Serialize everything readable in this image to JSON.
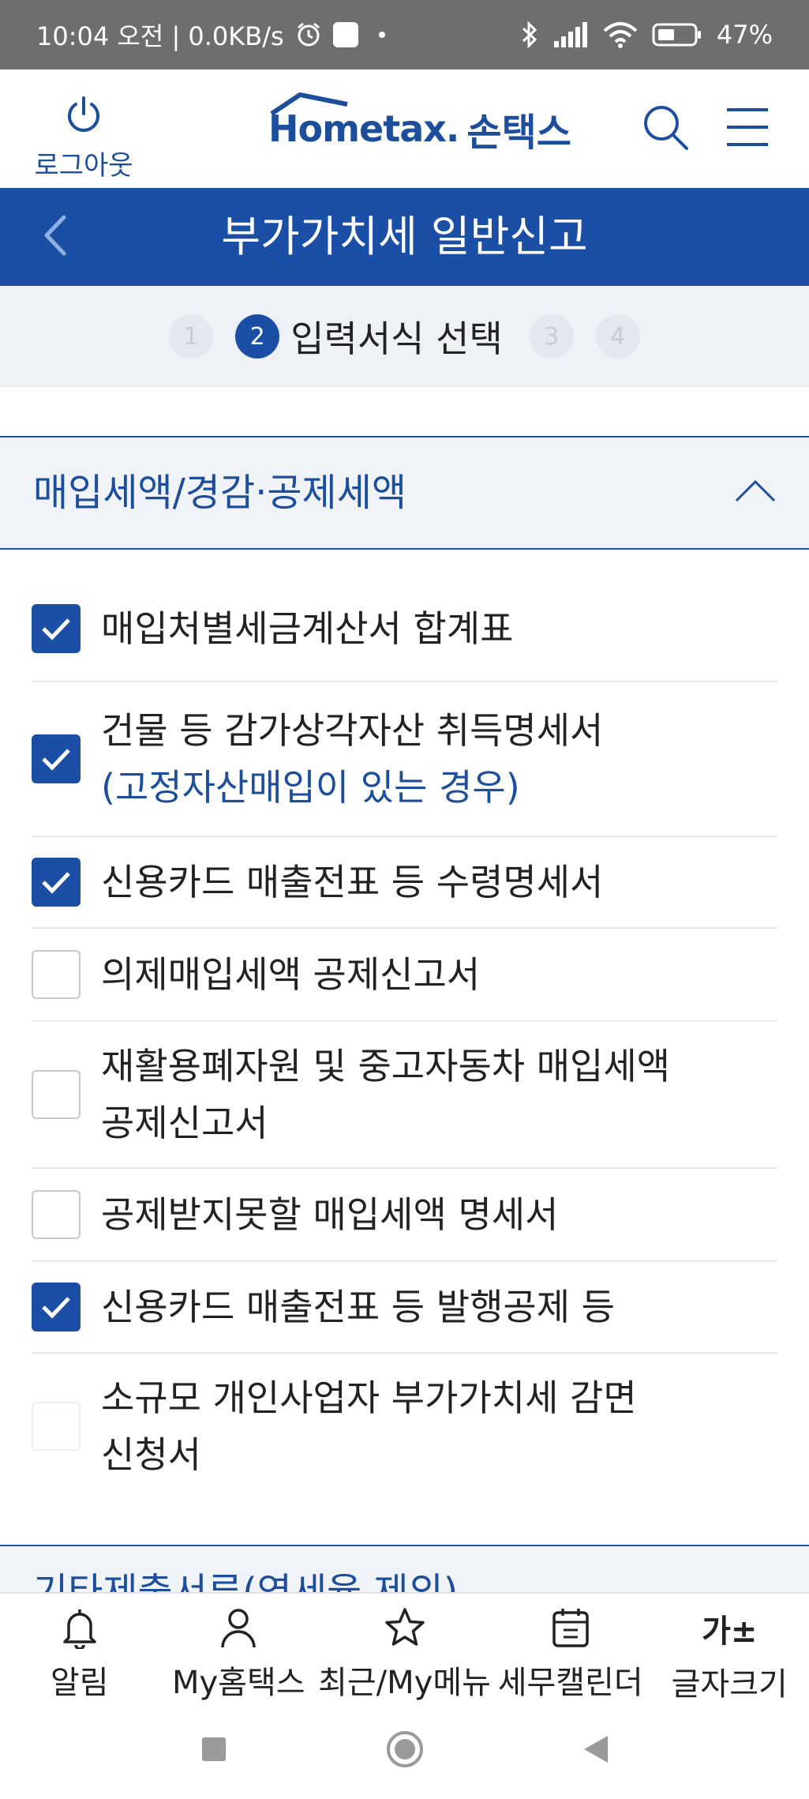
{
  "status": {
    "time": "10:04 오전 | 0.0KB/s",
    "battery": "47%"
  },
  "header": {
    "logout_label": "로그아웃",
    "logo_main": "Hometax.",
    "logo_sub": "손택스"
  },
  "titlebar": {
    "title": "부가가치세 일반신고"
  },
  "steps": {
    "items": [
      "1",
      "2",
      "3",
      "4"
    ],
    "active_label": "입력서식 선택"
  },
  "section": {
    "title": "매입세액/경감·공제세액"
  },
  "items": [
    {
      "line1": "매입처별세금계산서 합계표",
      "checked": true
    },
    {
      "line1": "건물 등 감가상각자산 취득명세서",
      "line2": "(고정자산매입이 있는 경우)",
      "checked": true
    },
    {
      "line1": "신용카드 매출전표 등 수령명세서",
      "checked": true
    },
    {
      "line1": "의제매입세액 공제신고서",
      "checked": false
    },
    {
      "line1": "재활용폐자원 및 중고자동차 매입세액",
      "line2": "공제신고서",
      "checked": false
    },
    {
      "line1": "공제받지못할 매입세액 명세서",
      "checked": false
    },
    {
      "line1": "신용카드 매출전표 등 발행공제 등",
      "checked": true
    },
    {
      "line1": "소규모 개인사업자 부가가치세 감면",
      "line2": "신청서",
      "checked": false
    }
  ],
  "section2": {
    "title": "기타제출서류(영세율 제외)"
  },
  "bottomnav": {
    "alarm": "알림",
    "my_hometax": "My홈택스",
    "recent": "최근/My메뉴",
    "calendar": "세무캘린더",
    "fontsize": "글자크기",
    "fontsize_icon": "가±"
  },
  "colors": {
    "primary": "#1a4fa5",
    "text_blue": "#1c4e9c",
    "status_bar": "#6e6e6e"
  }
}
